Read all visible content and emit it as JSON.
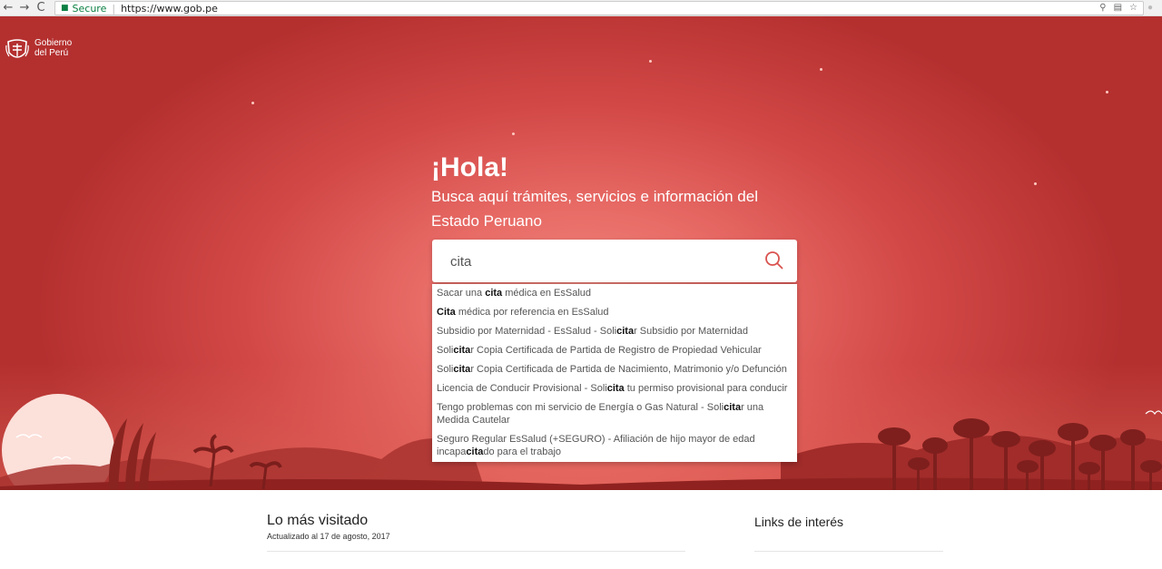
{
  "browser": {
    "secure_label": "Secure",
    "url": "https://www.gob.pe"
  },
  "header": {
    "logo_line1": "Gobierno",
    "logo_line2": "del Perú"
  },
  "hero": {
    "greeting": "¡Hola!",
    "subtitle": "Busca aquí trámites, servicios e información del Estado Peruano"
  },
  "search": {
    "value": "cita",
    "suggestions": [
      [
        "Sacar una ",
        "cita",
        " médica en EsSalud"
      ],
      [
        "",
        "Cita",
        " médica por referencia en EsSalud"
      ],
      [
        "Subsidio por Maternidad - EsSalud - Soli",
        "cita",
        "r Subsidio por Maternidad"
      ],
      [
        "Soli",
        "cita",
        "r Copia Certificada de Partida de Registro de Propiedad Vehicular"
      ],
      [
        "Soli",
        "cita",
        "r Copia Certificada de Partida de Nacimiento, Matrimonio y/o Defunción"
      ],
      [
        "Licencia de Conducir Provisional - Soli",
        "cita",
        " tu permiso provisional para conducir"
      ],
      [
        "Tengo problemas con mi servicio de Energía o Gas Natural - Soli",
        "cita",
        "r una Medida Cautelar"
      ],
      [
        "Seguro Regular EsSalud (+SEGURO) - Afiliación de hijo mayor de edad incapa",
        "cita",
        "do para el trabajo"
      ]
    ]
  },
  "most_visited": {
    "title": "Lo más visitado",
    "updated": "Actualizado al 17 de agosto, 2017"
  },
  "links": {
    "title": "Links de interés"
  },
  "colors": {
    "brand_red": "#c0392b",
    "secure_green": "#0b8043"
  }
}
